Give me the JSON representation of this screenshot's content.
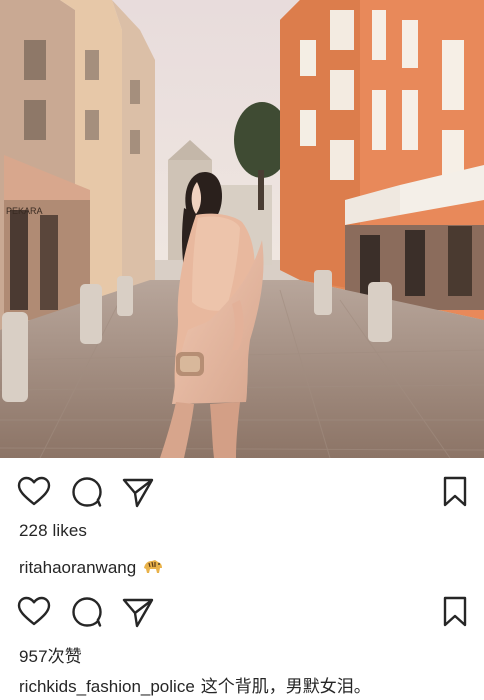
{
  "post1": {
    "likes_text": "228 likes",
    "username": "ritahaoranwang",
    "username_emoji": "tiger-emoji-icon",
    "shop_sign": "PEKARA"
  },
  "post2": {
    "likes_text": "957次赞",
    "username": "richkids_fashion_police",
    "caption": "这个背肌，男默女泪。"
  },
  "icons": {
    "like": "heart-outline-icon",
    "comment": "comment-bubble-icon",
    "share": "paper-plane-icon",
    "save": "bookmark-icon"
  }
}
